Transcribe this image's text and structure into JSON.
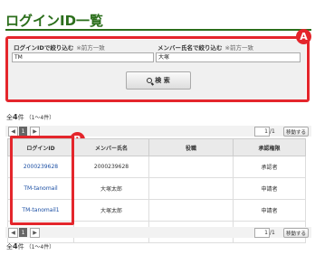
{
  "page": {
    "title": "ログインID一覧"
  },
  "search": {
    "login_label": "ログインIDで絞り込む",
    "login_hint": "※前方一致",
    "login_value": "TM",
    "member_label": "メンバー氏名で絞り込む",
    "member_hint": "※前方一致",
    "member_value": "大塚",
    "button_label": "検 索"
  },
  "badges": {
    "a": "A",
    "b": "B"
  },
  "results": {
    "count_prefix": "全",
    "count": "4",
    "count_suffix": "件",
    "range": "（1～4件）"
  },
  "pager": {
    "prev": "◀",
    "current": "1",
    "next": "▶",
    "page_input": "1",
    "total": "/1",
    "move_label": "移動する"
  },
  "table": {
    "headers": [
      "ログインID",
      "メンバー氏名",
      "役職",
      "承認権限"
    ],
    "rows": [
      [
        "2000239628",
        "2000239628",
        "",
        "承認者"
      ],
      [
        "TM-tanomail",
        "大塚太郎",
        "",
        "申請者"
      ],
      [
        "TM-tanomail1",
        "大塚太郎",
        "",
        "申請者"
      ],
      [
        "TM-tanomail2",
        "大塚太郎",
        "",
        "申請者"
      ]
    ]
  },
  "colors": {
    "brand_green": "#2b6e1b",
    "highlight_red": "#e4262c",
    "link_blue": "#1a4ea3"
  }
}
